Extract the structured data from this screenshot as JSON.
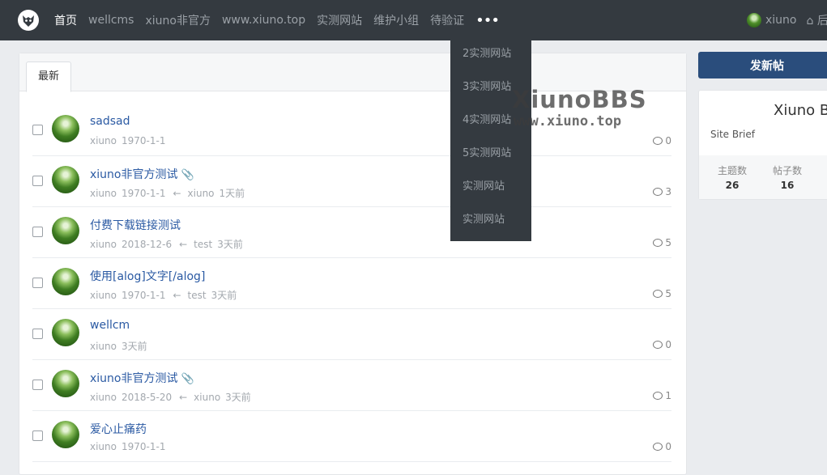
{
  "nav": {
    "links": [
      "首页",
      "wellcms",
      "xiuno非官方",
      "www.xiuno.top",
      "实测网站",
      "维护小组",
      "待验证"
    ],
    "more_label": "•••",
    "user": "xiuno",
    "home_label": "后台"
  },
  "dropdown": {
    "items": [
      "2实测网站",
      "3实测网站",
      "4实测网站",
      "5实测网站",
      "实测网站",
      "实测网站"
    ]
  },
  "main": {
    "tab_label": "最新",
    "threads": [
      {
        "title": "sadsad",
        "attachment": false,
        "author": "xiuno",
        "date": "1970-1-1",
        "last_user": "",
        "last_time": "",
        "replies": "0"
      },
      {
        "title": "xiuno非官方测试",
        "attachment": true,
        "author": "xiuno",
        "date": "1970-1-1",
        "last_user": "xiuno",
        "last_time": "1天前",
        "replies": "3"
      },
      {
        "title": "付费下载链接测试",
        "attachment": false,
        "author": "xiuno",
        "date": "2018-12-6",
        "last_user": "test",
        "last_time": "3天前",
        "replies": "5"
      },
      {
        "title": "使用[alog]文字[/alog]",
        "attachment": false,
        "author": "xiuno",
        "date": "1970-1-1",
        "last_user": "test",
        "last_time": "3天前",
        "replies": "5"
      },
      {
        "title": "wellcm",
        "attachment": false,
        "author": "xiuno",
        "date": "3天前",
        "last_user": "",
        "last_time": "",
        "replies": "0"
      },
      {
        "title": "xiuno非官方测试",
        "attachment": true,
        "author": "xiuno",
        "date": "2018-5-20",
        "last_user": "xiuno",
        "last_time": "3天前",
        "replies": "1"
      },
      {
        "title": "爱心止痛药",
        "attachment": false,
        "author": "xiuno",
        "date": "1970-1-1",
        "last_user": "",
        "last_time": "",
        "replies": "0"
      }
    ]
  },
  "sidebar": {
    "post_button": "发新帖",
    "site_title": "Xiuno BBS",
    "site_brief": "Site Brief",
    "stats": [
      {
        "label": "主题数",
        "value": "26"
      },
      {
        "label": "帖子数",
        "value": "16"
      }
    ]
  },
  "watermark": {
    "line1": "XiunoBBS",
    "line2": "www.xiuno.top"
  }
}
